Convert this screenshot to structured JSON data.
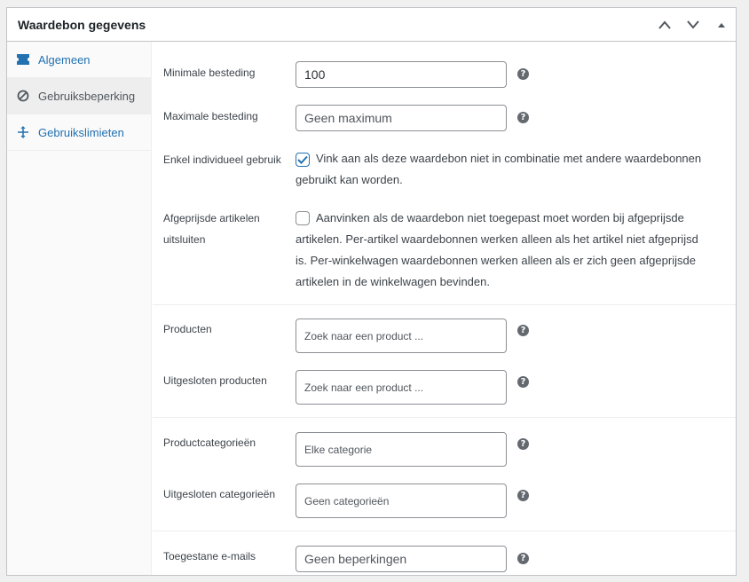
{
  "header": {
    "title": "Waardebon gegevens"
  },
  "tabs": [
    {
      "label": "Algemeen",
      "icon": "ticket-icon"
    },
    {
      "label": "Gebruiksbeperking",
      "icon": "block-icon"
    },
    {
      "label": "Gebruikslimieten",
      "icon": "arrows-icon"
    }
  ],
  "fields": {
    "min_spend": {
      "label": "Minimale besteding",
      "value": "100"
    },
    "max_spend": {
      "label": "Maximale besteding",
      "placeholder": "Geen maximum"
    },
    "individual_use": {
      "label": "Enkel individueel gebruik",
      "checked": true,
      "description": "Vink aan als deze waardebon niet in combinatie met andere waardebonnen gebruikt kan worden."
    },
    "exclude_sale": {
      "label": "Afgeprijsde artikelen uitsluiten",
      "checked": false,
      "description": "Aanvinken als de waardebon niet toegepast moet worden bij afgeprijsde artikelen. Per-artikel waardebonnen werken alleen als het artikel niet afgeprijsd is. Per-winkelwagen waardebonnen werken alleen als er zich geen afgeprijsde artikelen in de winkelwagen bevinden."
    },
    "products": {
      "label": "Producten",
      "placeholder": "Zoek naar een product ..."
    },
    "exclude_products": {
      "label": "Uitgesloten producten",
      "placeholder": "Zoek naar een product ..."
    },
    "categories": {
      "label": "Productcategorieën",
      "placeholder": "Elke categorie"
    },
    "exclude_categories": {
      "label": "Uitgesloten categorieën",
      "placeholder": "Geen categorieën"
    },
    "emails": {
      "label": "Toegestane e-mails",
      "placeholder": "Geen beperkingen"
    }
  },
  "help_glyph": "?",
  "colors": {
    "accent": "#2271b1",
    "border": "#c3c4c7",
    "help": "#646970"
  }
}
